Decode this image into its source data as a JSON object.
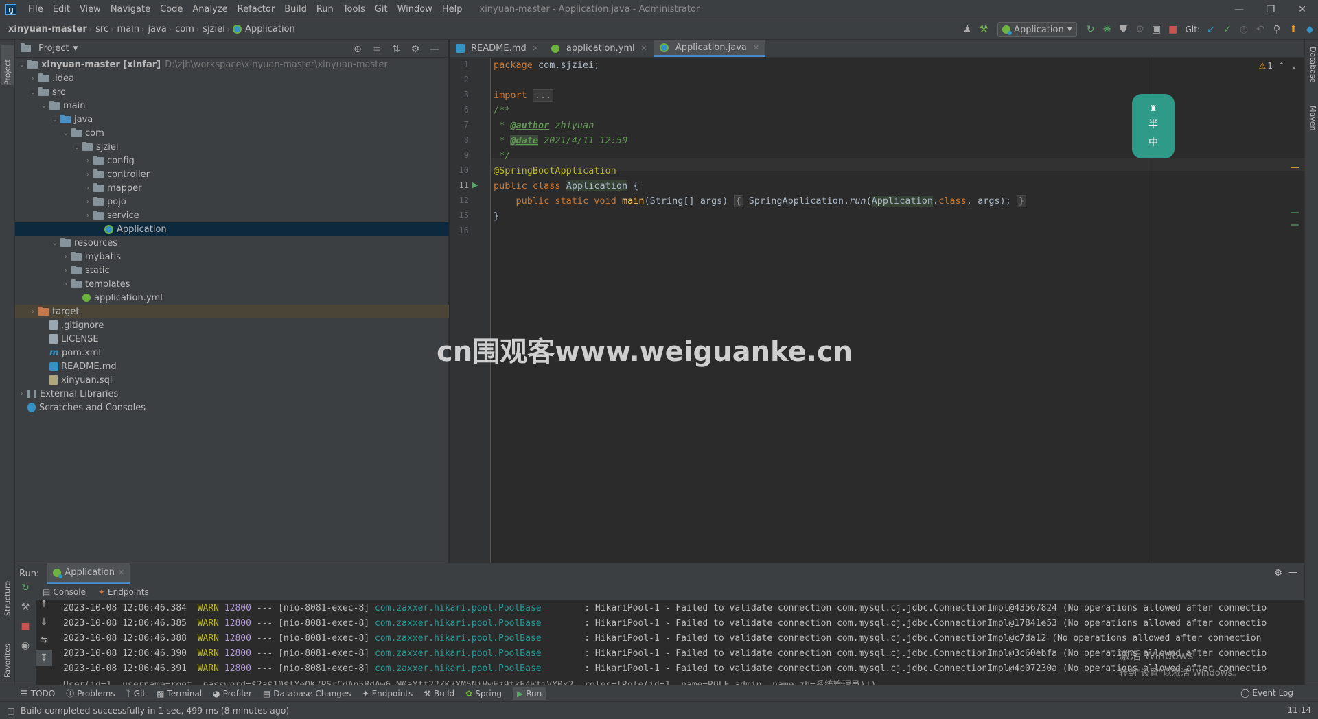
{
  "menubar": {
    "items": [
      "File",
      "Edit",
      "View",
      "Navigate",
      "Code",
      "Analyze",
      "Refactor",
      "Build",
      "Run",
      "Tools",
      "Git",
      "Window",
      "Help"
    ],
    "title": "xinyuan-master - Application.java - Administrator"
  },
  "breadcrumb": [
    "xinyuan-master",
    "src",
    "main",
    "java",
    "com",
    "sjziei",
    "Application"
  ],
  "toolbar": {
    "run_config": "Application",
    "git_label": "Git:"
  },
  "left_strip": {
    "project": "Project",
    "structure": "Structure",
    "favorites": "Favorites"
  },
  "right_strip": {
    "database": "Database",
    "maven": "Maven"
  },
  "project": {
    "title": "Project",
    "tree": [
      {
        "label": "xinyuan-master [xinfar]",
        "path": "D:\\zjh\\workspace\\xinyuan-master\\xinyuan-master"
      },
      {
        "label": ".idea"
      },
      {
        "label": "src"
      },
      {
        "label": "main"
      },
      {
        "label": "java"
      },
      {
        "label": "com"
      },
      {
        "label": "sjziei"
      },
      {
        "label": "config"
      },
      {
        "label": "controller"
      },
      {
        "label": "mapper"
      },
      {
        "label": "pojo"
      },
      {
        "label": "service"
      },
      {
        "label": "Application"
      },
      {
        "label": "resources"
      },
      {
        "label": "mybatis"
      },
      {
        "label": "static"
      },
      {
        "label": "templates"
      },
      {
        "label": "application.yml"
      },
      {
        "label": "target"
      },
      {
        "label": ".gitignore"
      },
      {
        "label": "LICENSE"
      },
      {
        "label": "pom.xml"
      },
      {
        "label": "README.md"
      },
      {
        "label": "xinyuan.sql"
      },
      {
        "label": "External Libraries"
      },
      {
        "label": "Scratches and Consoles"
      }
    ]
  },
  "editor": {
    "tabs": [
      "README.md",
      "application.yml",
      "Application.java"
    ],
    "active_tab": "Application.java",
    "line_numbers": [
      "1",
      "2",
      "3",
      "6",
      "7",
      "8",
      "9",
      "10",
      "11",
      "12",
      "15",
      "16"
    ],
    "code": {
      "l1_kw": "package",
      "l1_rest": " com.sjziei;",
      "l3_kw": "import",
      "l3_fold": "...",
      "l6": "/**",
      "l7_pre": " * ",
      "l7_tag": "@author",
      "l7_rest": " zhiyuan",
      "l8_pre": " * ",
      "l8_tag": "@date",
      "l8_rest": " 2021/4/11 12:50",
      "l9": " */",
      "l10": "@SpringBootApplication",
      "l11_kw": "public class",
      "l11_cls": "Application",
      "l11_rest": " {",
      "l12_kw": "    public static void",
      "l12_m": "main",
      "l12_args": "(String[] args) ",
      "l12_fold1": "{",
      "l12_call": " SpringApplication.",
      "l12_run": "run",
      "l12_p1": "(",
      "l12_cls": "Application",
      "l12_p2": ".",
      "l12_class": "class",
      "l12_p3": ", args); ",
      "l12_fold2": "}",
      "l15": "}"
    },
    "warning_count": "1",
    "sticker": [
      "半",
      "中"
    ]
  },
  "watermark": "cn围观客www.weiguanke.cn",
  "run": {
    "label": "Run:",
    "tab": "Application",
    "subtabs": [
      "Console",
      "Endpoints"
    ],
    "log": [
      {
        "ts": "2023-10-08 12:06:46.384",
        "lvl": "WARN",
        "pid": "12800",
        "sep": " --- ",
        "thr": "[nio-8081-exec-8]",
        "logger": "com.zaxxer.hikari.pool.PoolBase",
        "msg": "        : HikariPool-1 - Failed to validate connection com.mysql.cj.jdbc.ConnectionImpl@43567824 (No operations allowed after connectio"
      },
      {
        "ts": "2023-10-08 12:06:46.385",
        "lvl": "WARN",
        "pid": "12800",
        "sep": " --- ",
        "thr": "[nio-8081-exec-8]",
        "logger": "com.zaxxer.hikari.pool.PoolBase",
        "msg": "        : HikariPool-1 - Failed to validate connection com.mysql.cj.jdbc.ConnectionImpl@17841e53 (No operations allowed after connectio"
      },
      {
        "ts": "2023-10-08 12:06:46.388",
        "lvl": "WARN",
        "pid": "12800",
        "sep": " --- ",
        "thr": "[nio-8081-exec-8]",
        "logger": "com.zaxxer.hikari.pool.PoolBase",
        "msg": "        : HikariPool-1 - Failed to validate connection com.mysql.cj.jdbc.ConnectionImpl@c7da12 (No operations allowed after connection"
      },
      {
        "ts": "2023-10-08 12:06:46.390",
        "lvl": "WARN",
        "pid": "12800",
        "sep": " --- ",
        "thr": "[nio-8081-exec-8]",
        "logger": "com.zaxxer.hikari.pool.PoolBase",
        "msg": "        : HikariPool-1 - Failed to validate connection com.mysql.cj.jdbc.ConnectionImpl@3c60ebfa (No operations allowed after connectio"
      },
      {
        "ts": "2023-10-08 12:06:46.391",
        "lvl": "WARN",
        "pid": "12800",
        "sep": " --- ",
        "thr": "[nio-8081-exec-8]",
        "logger": "com.zaxxer.hikari.pool.PoolBase",
        "msg": "        : HikariPool-1 - Failed to validate connection com.mysql.cj.jdbc.ConnectionImpl@4c07230a (No operations allowed after connectio"
      }
    ],
    "last_line": "User(id=1, username=root, password=$2a$10$lYeOK7PSrCdAn5BdAw6.M0aYff22ZK7XM5NiVwEz9tkE4WtiVY0x2, roles=[Role(id=1, name=ROLE_admin, name_zh=系统管理员)])"
  },
  "bottom_tabs": [
    "TODO",
    "Problems",
    "Git",
    "Terminal",
    "Profiler",
    "Database Changes",
    "Endpoints",
    "Build",
    "Spring",
    "Run"
  ],
  "event_log": "Event Log",
  "windows_activation": [
    "激活 Windows",
    "转到\"设置\"以激活 Windows。"
  ],
  "status": {
    "message": "Build completed successfully in 1 sec, 499 ms (8 minutes ago)",
    "position": "11:14"
  },
  "colors": {
    "accent": "#4a88c7",
    "spring": "#6db33f",
    "warn": "#bbb529",
    "keyword": "#cc7832"
  }
}
